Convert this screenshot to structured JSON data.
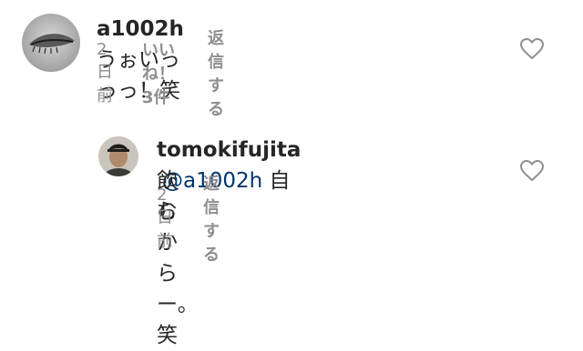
{
  "comment": {
    "username": "a1002h",
    "text": "うぉいっっっ！笑",
    "time": "2日前",
    "likes": "いいね！3件",
    "reply": "返信する",
    "heart_icon": "heart-outline-icon"
  },
  "reply_comment": {
    "username": "tomokifujita",
    "mention": "@a1002h",
    "text_line1": "自ら",
    "text_line2": "飲むからー。笑",
    "time": "2日前",
    "reply": "返信する",
    "heart_icon": "heart-outline-icon"
  },
  "colors": {
    "text": "#262626",
    "meta": "#8e8e8e",
    "mention": "#003569"
  }
}
